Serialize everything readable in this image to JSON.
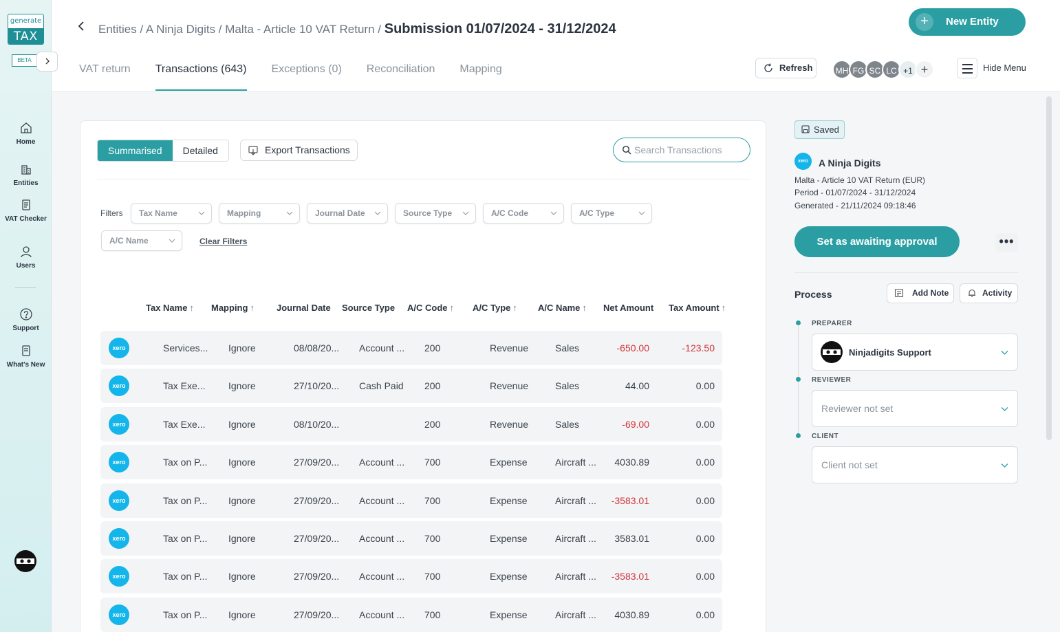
{
  "brand": {
    "logo_top": "generate",
    "logo_bottom": "TAX",
    "badge": "BETA"
  },
  "nav": {
    "items": [
      {
        "label": "Home"
      },
      {
        "label": "Entities"
      },
      {
        "label": "VAT Checker"
      },
      {
        "label": "Users"
      },
      {
        "label": "Support"
      },
      {
        "label": "What's New"
      }
    ]
  },
  "header": {
    "breadcrumb": "Entities / A Ninja Digits / Malta - Article 10 VAT Return /",
    "current": "Submission 01/07/2024 - 31/12/2024",
    "new_entity_label": "New Entity",
    "tabs": [
      {
        "label": "VAT return"
      },
      {
        "label": "Transactions (643)"
      },
      {
        "label": "Exceptions (0)"
      },
      {
        "label": "Reconciliation"
      },
      {
        "label": "Mapping"
      }
    ],
    "refresh_label": "Refresh",
    "avatars": [
      "MH",
      "FG",
      "SC",
      "LC"
    ],
    "avatars_more": "+1",
    "avatar_add": "+",
    "hide_menu_label": "Hide Menu"
  },
  "toolbar": {
    "summarised_label": "Summarised",
    "detailed_label": "Detailed",
    "export_label": "Export Transactions",
    "search_placeholder": "Search Transactions"
  },
  "filters": {
    "label": "Filters",
    "items": [
      "Tax Name",
      "Mapping",
      "Journal Date",
      "Source Type",
      "A/C Code",
      "A/C Type",
      "A/C Name"
    ],
    "clear_label": "Clear Filters"
  },
  "table": {
    "columns": [
      "Tax Name",
      "Mapping",
      "Journal Date",
      "Source Type",
      "A/C Code",
      "A/C Type",
      "A/C Name",
      "Net Amount",
      "Tax Amount"
    ],
    "xero_badge": "xero",
    "rows": [
      {
        "tax_name": "Services...",
        "mapping": "Ignore",
        "date": "08/08/20...",
        "source": "Account ...",
        "code": "200",
        "type": "Revenue",
        "name": "Sales",
        "net": "-650.00",
        "tax": "-123.50"
      },
      {
        "tax_name": "Tax Exe...",
        "mapping": "Ignore",
        "date": "27/10/20...",
        "source": "Cash Paid",
        "code": "200",
        "type": "Revenue",
        "name": "Sales",
        "net": "44.00",
        "tax": "0.00"
      },
      {
        "tax_name": "Tax Exe...",
        "mapping": "Ignore",
        "date": "08/10/20...",
        "source": "",
        "code": "200",
        "type": "Revenue",
        "name": "Sales",
        "net": "-69.00",
        "tax": "0.00"
      },
      {
        "tax_name": "Tax on P...",
        "mapping": "Ignore",
        "date": "27/09/20...",
        "source": "Account ...",
        "code": "700",
        "type": "Expense",
        "name": "Aircraft ...",
        "net": "4030.89",
        "tax": "0.00"
      },
      {
        "tax_name": "Tax on P...",
        "mapping": "Ignore",
        "date": "27/09/20...",
        "source": "Account ...",
        "code": "700",
        "type": "Expense",
        "name": "Aircraft ...",
        "net": "-3583.01",
        "tax": "0.00"
      },
      {
        "tax_name": "Tax on P...",
        "mapping": "Ignore",
        "date": "27/09/20...",
        "source": "Account ...",
        "code": "700",
        "type": "Expense",
        "name": "Aircraft ...",
        "net": "3583.01",
        "tax": "0.00"
      },
      {
        "tax_name": "Tax on P...",
        "mapping": "Ignore",
        "date": "27/09/20...",
        "source": "Account ...",
        "code": "700",
        "type": "Expense",
        "name": "Aircraft ...",
        "net": "-3583.01",
        "tax": "0.00"
      },
      {
        "tax_name": "Tax on P...",
        "mapping": "Ignore",
        "date": "27/09/20...",
        "source": "Account ...",
        "code": "700",
        "type": "Expense",
        "name": "Aircraft ...",
        "net": "4030.89",
        "tax": "0.00"
      }
    ]
  },
  "panel": {
    "saved_label": "Saved",
    "entity_logo": "xero",
    "entity_name": "A Ninja Digits",
    "return_name": "Malta - Article 10 VAT Return (EUR)",
    "period": "Period - 01/07/2024 - 31/12/2024",
    "generated": "Generated - 21/11/2024 09:18:46",
    "approval_label": "Set as awaiting approval",
    "more_label": "•••",
    "process_label": "Process",
    "add_note_label": "Add Note",
    "activity_label": "Activity",
    "preparer_label": "PREPARER",
    "preparer_value": "Ninjadigits Support",
    "reviewer_label": "REVIEWER",
    "reviewer_value": "Reviewer not set",
    "client_label": "CLIENT",
    "client_value": "Client not set"
  },
  "colors": {
    "accent": "#2a9ea3",
    "negative": "#d0343c",
    "xero": "#13b5ea"
  }
}
